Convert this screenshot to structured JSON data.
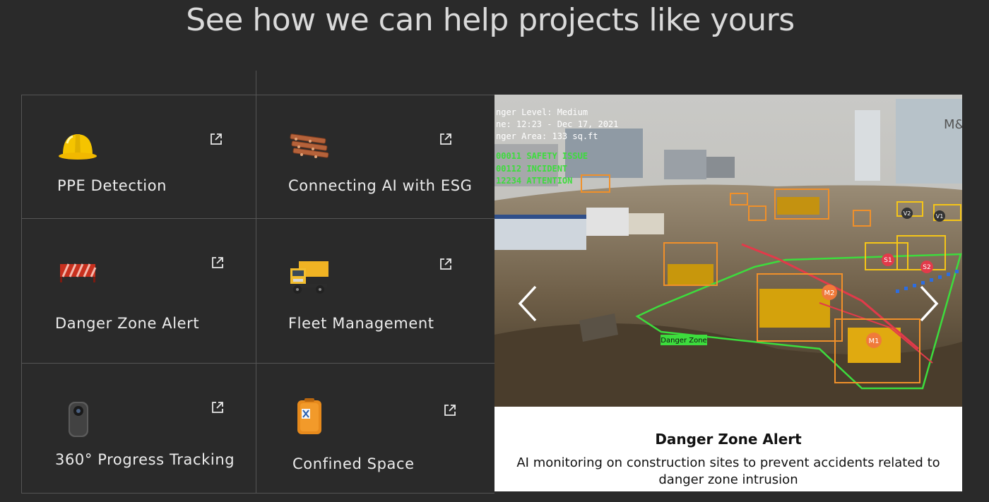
{
  "page": {
    "title": "See how we can help projects like yours"
  },
  "colors": {
    "background": "#2a2a2a",
    "grid_line": "#555555",
    "overlay_green": "#3ddc3d",
    "box_orange": "#f0902a",
    "box_yellow": "#f5c518"
  },
  "services": [
    {
      "label": "PPE Detection",
      "icon": "hard-hat-icon"
    },
    {
      "label": "Connecting AI with ESG",
      "icon": "timber-stack-icon"
    },
    {
      "label": "Danger Zone Alert",
      "icon": "barrier-icon"
    },
    {
      "label": "Fleet Management",
      "icon": "dump-truck-icon"
    },
    {
      "label": "360° Progress Tracking",
      "icon": "360-camera-icon"
    },
    {
      "label": "Confined Space",
      "icon": "gas-detector-case-icon"
    }
  ],
  "slide": {
    "caption_title": "Danger Zone Alert",
    "caption_desc": "AI monitoring on construction sites to prevent accidents related to danger zone intrusion",
    "overlay": {
      "line1": "nger Level: Medium",
      "line2": "ne: 12:23 - Dec 17, 2021",
      "line3": "nger Area: 133 sq.ft",
      "line4": "00011 SAFETY ISSUE",
      "line5": "00112 INCIDENT",
      "line6": "12234 ATTENTION"
    },
    "zone_label": "Danger Zone",
    "markers": {
      "m1": "M1",
      "m2": "M2",
      "s1": "S1",
      "s2": "S2",
      "v1": "V1",
      "v2": "V2"
    },
    "sign_text": "M&"
  }
}
